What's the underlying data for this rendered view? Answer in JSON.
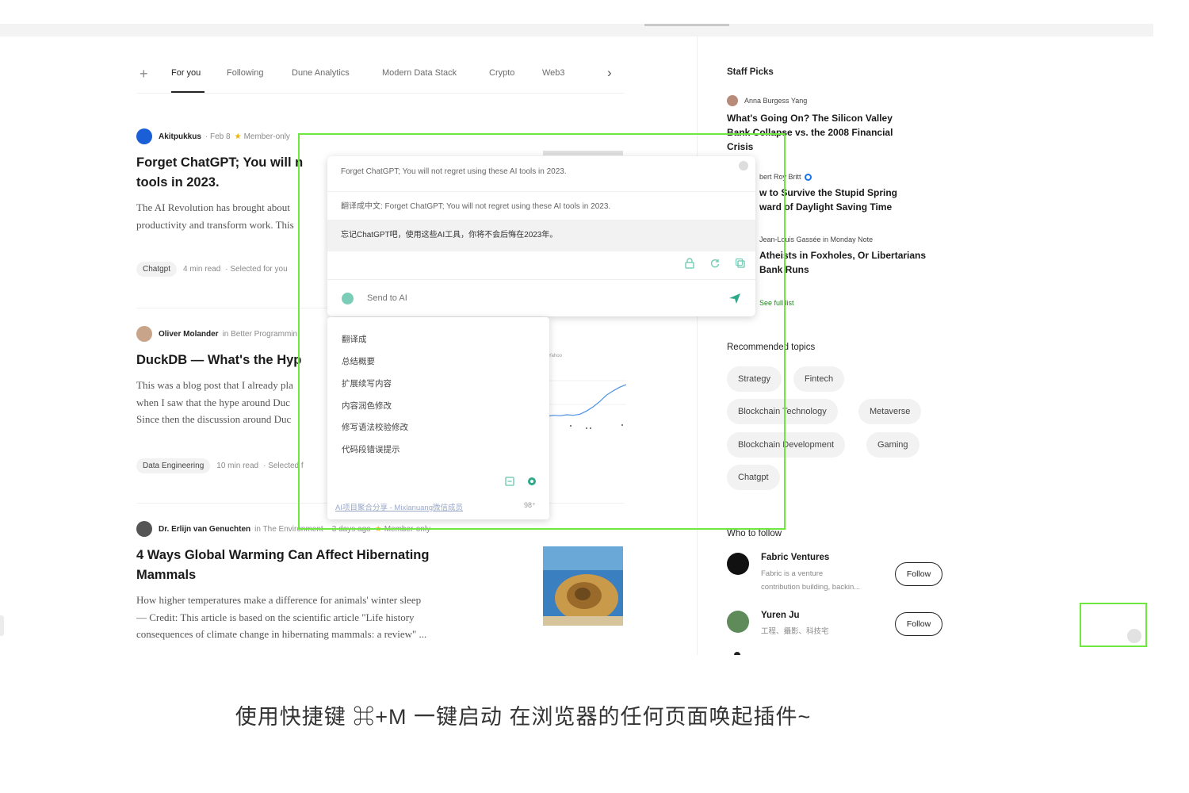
{
  "tabs": {
    "plus": "+",
    "items": [
      "For you",
      "Following",
      "Dune Analytics",
      "Modern Data Stack",
      "Crypto",
      "Web3"
    ],
    "next": "›"
  },
  "articles": [
    {
      "author": "Akitpukkus",
      "date": "· Feb 8",
      "star": "★",
      "badge": "Member-only",
      "title": "Forget ChatGPT; You will n",
      "title2": "tools in 2023.",
      "excerpt1": "The AI Revolution has brought about",
      "excerpt2": "productivity and transform work. This",
      "tag": "Chatgpt",
      "read": "4 min read",
      "sel": "· Selected for you"
    },
    {
      "author": "Oliver Molander",
      "in": "in Better Programmin",
      "title": "DuckDB — What's the Hyp",
      "excerpt1": "This was a blog post that I already pla",
      "excerpt2": "when I saw that the hype around Duc",
      "excerpt3": "Since then the discussion around Duc",
      "tag": "Data Engineering",
      "read": "10 min read",
      "sel": "· Selected f"
    },
    {
      "author": "Dr. Erlijn van Genuchten",
      "in": "in The Environment",
      "date": "· 3 days ago",
      "star": "★",
      "badge": "Member-only",
      "title1": "4 Ways Global Warming Can Affect Hibernating",
      "title2": "Mammals",
      "excerpt1": "How higher temperatures make a difference for animals' winter sleep",
      "excerpt2": "— Credit: This article is based on the scientific article \"Life history",
      "excerpt3": "consequences of climate change in hibernating mammals: a review\" ..."
    }
  ],
  "sidebar": {
    "staff_picks_title": "Staff Picks",
    "picks": [
      {
        "author": "Anna Burgess Yang",
        "title": "What's Going On? The Silicon Valley",
        "title2": "Bank Collapse vs. the 2008 Financial",
        "title3": "Crisis"
      },
      {
        "author": "bert Roy Britt",
        "title": "w to Survive the Stupid Spring",
        "title2": "ward of Daylight Saving Time"
      },
      {
        "author": "Jean-Louis Gassée in Monday Note",
        "title": "Atheists in Foxholes, Or Libertarians",
        "title2": "Bank Runs"
      }
    ],
    "see_full": "See full list",
    "recommended_title": "Recommended topics",
    "topics": [
      "Strategy",
      "Fintech",
      "Blockchain Technology",
      "Metaverse",
      "Blockchain Development",
      "Gaming",
      "Chatgpt"
    ],
    "who_to_follow_title": "Who to follow",
    "follow": [
      {
        "name": "Fabric Ventures",
        "desc": "Fabric is a venture",
        "desc2": "contribution building, backin...",
        "button": "Follow"
      },
      {
        "name": "Yuren Ju",
        "desc": "工程、攝影、科技宅",
        "button": "Follow"
      }
    ]
  },
  "popup": {
    "line1": "Forget ChatGPT; You will not regret using these AI tools in 2023.",
    "line2": "翻译成中文: Forget ChatGPT; You will not regret using these AI tools in 2023.",
    "line3": "忘记ChatGPT吧，使用这些AI工具，你将不会后悔在2023年。",
    "input_placeholder": "Send to AI"
  },
  "dropdown": {
    "items": [
      "翻译成",
      "总结概要",
      "扩展续写内容",
      "内容润色修改",
      "修写语法校验修改",
      "代码段错误提示"
    ],
    "link": "AI项目聚合分享 - Mixlanuang微信成员",
    "badge": "98⁺"
  },
  "caption": "使用快捷键 ⌘+M 一键启动 在浏览器的任何页面唤起插件~",
  "colors": {
    "highlight": "#6ee83f",
    "accent_green": "#1a8917",
    "star": "#f0b400"
  },
  "chart_thumb": {
    "label": "Yahoo",
    "series": [
      20,
      22,
      21,
      23,
      22,
      24,
      30,
      38,
      48,
      60,
      68,
      75,
      80
    ]
  }
}
